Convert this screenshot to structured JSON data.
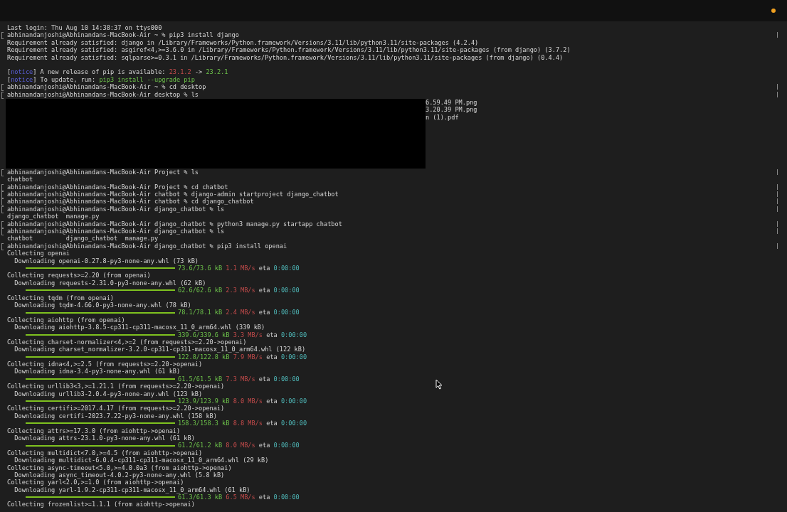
{
  "lines": [
    {
      "kind": "plain",
      "text": "Last login: Thu Aug 10 14:38:37 on ttys000"
    },
    {
      "kind": "prompt",
      "text": "abhinandanjoshi@Abhinandans-MacBook-Air ~ % pip3 install django"
    },
    {
      "kind": "plain",
      "text": "Requirement already satisfied: django in /Library/Frameworks/Python.framework/Versions/3.11/lib/python3.11/site-packages (4.2.4)"
    },
    {
      "kind": "plain",
      "text": "Requirement already satisfied: asgiref<4,>=3.6.0 in /Library/Frameworks/Python.framework/Versions/3.11/lib/python3.11/site-packages (from django) (3.7.2)"
    },
    {
      "kind": "plain",
      "text": "Requirement already satisfied: sqlparse>=0.3.1 in /Library/Frameworks/Python.framework/Versions/3.11/lib/python3.11/site-packages (from django) (0.4.4)"
    },
    {
      "kind": "blank"
    },
    {
      "kind": "notice",
      "open": "[",
      "tag": "notice",
      "close": "] ",
      "text": "A new release of pip is available: ",
      "old": "23.1.2",
      "arrow": " -> ",
      "new": "23.2.1"
    },
    {
      "kind": "notice",
      "open": "[",
      "tag": "notice",
      "close": "] ",
      "text": "To update, run: ",
      "command": "pip3 install --upgrade pip"
    },
    {
      "kind": "prompt",
      "text": "abhinandanjoshi@Abhinandans-MacBook-Air ~ % cd desktop"
    },
    {
      "kind": "prompt",
      "text": "abhinandanjoshi@Abhinandans-MacBook-Air desktop % ls"
    },
    {
      "kind": "redacted",
      "tails": [
        "6.59.49 PM.png",
        "3.20.39 PM.png",
        "n (1).pdf"
      ]
    },
    {
      "kind": "prompt",
      "text": "abhinandanjoshi@Abhinandans-MacBook-Air Project % ls"
    },
    {
      "kind": "plain",
      "text": "chatbot"
    },
    {
      "kind": "prompt",
      "text": "abhinandanjoshi@Abhinandans-MacBook-Air Project % cd chatbot"
    },
    {
      "kind": "prompt",
      "text": "abhinandanjoshi@Abhinandans-MacBook-Air chatbot % django-admin startproject django_chatbot"
    },
    {
      "kind": "prompt",
      "text": "abhinandanjoshi@Abhinandans-MacBook-Air chatbot % cd django_chatbot"
    },
    {
      "kind": "prompt",
      "text": "abhinandanjoshi@Abhinandans-MacBook-Air django_chatbot % ls"
    },
    {
      "kind": "plain",
      "text": "django_chatbot  manage.py"
    },
    {
      "kind": "prompt",
      "text": "abhinandanjoshi@Abhinandans-MacBook-Air django_chatbot % python3 manage.py startapp chatbot"
    },
    {
      "kind": "prompt",
      "text": "abhinandanjoshi@Abhinandans-MacBook-Air django_chatbot % ls"
    },
    {
      "kind": "plain",
      "text": "chatbot         django_chatbot  manage.py"
    },
    {
      "kind": "prompt",
      "text": "abhinandanjoshi@Abhinandans-MacBook-Air django_chatbot % pip3 install openai"
    },
    {
      "kind": "plain",
      "text": "Collecting openai"
    },
    {
      "kind": "plain",
      "text": "  Downloading openai-0.27.8-py3-none-any.whl (73 kB)"
    },
    {
      "kind": "progress",
      "level": 1,
      "size": "73.6/73.6 kB",
      "speed": "1.1 MB/s",
      "eta_label": "eta",
      "eta": "0:00:00"
    },
    {
      "kind": "plain",
      "text": "Collecting requests>=2.20 (from openai)"
    },
    {
      "kind": "plain",
      "text": "  Downloading requests-2.31.0-py3-none-any.whl (62 kB)"
    },
    {
      "kind": "progress",
      "level": 1,
      "size": "62.6/62.6 kB",
      "speed": "2.3 MB/s",
      "eta_label": "eta",
      "eta": "0:00:00"
    },
    {
      "kind": "plain",
      "text": "Collecting tqdm (from openai)"
    },
    {
      "kind": "plain",
      "text": "  Downloading tqdm-4.66.0-py3-none-any.whl (78 kB)"
    },
    {
      "kind": "progress",
      "level": 1,
      "size": "78.1/78.1 kB",
      "speed": "2.4 MB/s",
      "eta_label": "eta",
      "eta": "0:00:00"
    },
    {
      "kind": "plain",
      "text": "Collecting aiohttp (from openai)"
    },
    {
      "kind": "plain",
      "text": "  Downloading aiohttp-3.8.5-cp311-cp311-macosx_11_0_arm64.whl (339 kB)"
    },
    {
      "kind": "progress",
      "level": 1,
      "size": "339.6/339.6 kB",
      "speed": "3.3 MB/s",
      "eta_label": "eta",
      "eta": "0:00:00"
    },
    {
      "kind": "plain",
      "text": "Collecting charset-normalizer<4,>=2 (from requests>=2.20->openai)"
    },
    {
      "kind": "plain",
      "text": "  Downloading charset_normalizer-3.2.0-cp311-cp311-macosx_11_0_arm64.whl (122 kB)"
    },
    {
      "kind": "progress",
      "level": 1,
      "size": "122.8/122.8 kB",
      "speed": "7.9 MB/s",
      "eta_label": "eta",
      "eta": "0:00:00"
    },
    {
      "kind": "plain",
      "text": "Collecting idna<4,>=2.5 (from requests>=2.20->openai)"
    },
    {
      "kind": "plain",
      "text": "  Downloading idna-3.4-py3-none-any.whl (61 kB)"
    },
    {
      "kind": "progress",
      "level": 1,
      "size": "61.5/61.5 kB",
      "speed": "7.3 MB/s",
      "eta_label": "eta",
      "eta": "0:00:00"
    },
    {
      "kind": "plain",
      "text": "Collecting urllib3<3,>=1.21.1 (from requests>=2.20->openai)"
    },
    {
      "kind": "plain",
      "text": "  Downloading urllib3-2.0.4-py3-none-any.whl (123 kB)"
    },
    {
      "kind": "progress",
      "level": 1,
      "size": "123.9/123.9 kB",
      "speed": "8.0 MB/s",
      "eta_label": "eta",
      "eta": "0:00:00"
    },
    {
      "kind": "plain",
      "text": "Collecting certifi>=2017.4.17 (from requests>=2.20->openai)"
    },
    {
      "kind": "plain",
      "text": "  Downloading certifi-2023.7.22-py3-none-any.whl (158 kB)"
    },
    {
      "kind": "progress",
      "level": 1,
      "size": "158.3/158.3 kB",
      "speed": "8.8 MB/s",
      "eta_label": "eta",
      "eta": "0:00:00"
    },
    {
      "kind": "plain",
      "text": "Collecting attrs>=17.3.0 (from aiohttp->openai)"
    },
    {
      "kind": "plain",
      "text": "  Downloading attrs-23.1.0-py3-none-any.whl (61 kB)"
    },
    {
      "kind": "progress",
      "level": 1,
      "size": "61.2/61.2 kB",
      "speed": "8.0 MB/s",
      "eta_label": "eta",
      "eta": "0:00:00"
    },
    {
      "kind": "plain",
      "text": "Collecting multidict<7.0,>=4.5 (from aiohttp->openai)"
    },
    {
      "kind": "plain",
      "text": "  Downloading multidict-6.0.4-cp311-cp311-macosx_11_0_arm64.whl (29 kB)"
    },
    {
      "kind": "plain",
      "text": "Collecting async-timeout<5.0,>=4.0.0a3 (from aiohttp->openai)"
    },
    {
      "kind": "plain",
      "text": "  Downloading async_timeout-4.0.2-py3-none-any.whl (5.8 kB)"
    },
    {
      "kind": "plain",
      "text": "Collecting yarl<2.0,>=1.0 (from aiohttp->openai)"
    },
    {
      "kind": "plain",
      "text": "  Downloading yarl-1.9.2-cp311-cp311-macosx_11_0_arm64.whl (61 kB)"
    },
    {
      "kind": "progress",
      "level": 1,
      "size": "61.3/61.3 kB",
      "speed": "6.5 MB/s",
      "eta_label": "eta",
      "eta": "0:00:00"
    },
    {
      "kind": "plain",
      "text": "Collecting frozenlist>=1.1.1 (from aiohttp->openai)"
    }
  ]
}
